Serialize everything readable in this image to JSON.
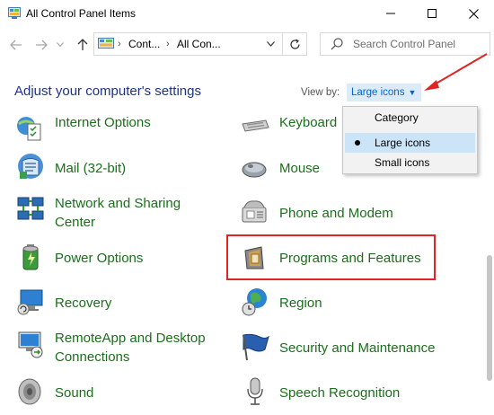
{
  "window": {
    "title": "All Control Panel Items"
  },
  "address": {
    "segments": [
      "Cont...",
      "All Con..."
    ]
  },
  "search": {
    "placeholder": "Search Control Panel"
  },
  "header": {
    "heading": "Adjust your computer's settings",
    "view_by_label": "View by:",
    "view_by_value": "Large icons"
  },
  "view_menu": {
    "options": [
      "Category",
      "Large icons",
      "Small icons"
    ],
    "selected": "Large icons"
  },
  "items": {
    "internet_options": "Internet Options",
    "keyboard": "Keyboard",
    "mail": "Mail (32-bit)",
    "mouse": "Mouse",
    "network_line1": "Network and Sharing",
    "network_line2": "Center",
    "phone_modem": "Phone and Modem",
    "power_options": "Power Options",
    "programs_features": "Programs and Features",
    "recovery": "Recovery",
    "region": "Region",
    "remoteapp_line1": "RemoteApp and Desktop",
    "remoteapp_line2": "Connections",
    "security_maintenance": "Security and Maintenance",
    "sound": "Sound",
    "speech_recognition": "Speech Recognition"
  },
  "colors": {
    "heading": "#1e3287",
    "item_link": "#1b6e1b",
    "highlight": "#e02424",
    "view_by_value": "#0066cc"
  }
}
